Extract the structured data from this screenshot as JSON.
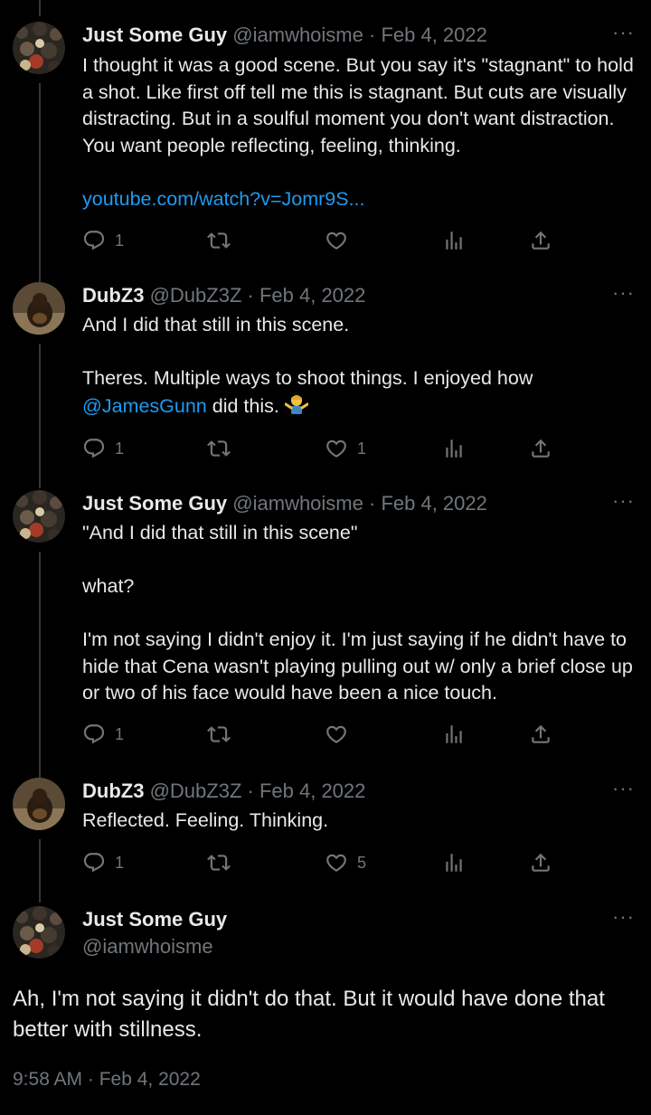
{
  "tweets": [
    {
      "name": "Just Some Guy",
      "handle": "@iamwhoisme",
      "sep": "·",
      "date": "Feb 4, 2022",
      "more": "···",
      "text1": "I thought it was a good scene. But you say it's \"stagnant\" to hold a shot. Like first off tell me this is stagnant. But cuts are visually distracting. But in a soulful moment you don't want distraction. You want people reflecting, feeling, thinking.",
      "link": "youtube.com/watch?v=Jomr9S...",
      "replies": "1",
      "likes": ""
    },
    {
      "name": "DubZ3",
      "handle": "@DubZ3Z",
      "sep": "·",
      "date": "Feb 4, 2022",
      "more": "···",
      "text1": "And I did that still in this scene.",
      "text2a": "Theres. Multiple ways to shoot things. I enjoyed how",
      "mention": "@JamesGunn",
      "text2b": "did this.",
      "emoji": "man-shrugging-emoji",
      "replies": "1",
      "likes": "1"
    },
    {
      "name": "Just Some Guy",
      "handle": "@iamwhoisme",
      "sep": "·",
      "date": "Feb 4, 2022",
      "more": "···",
      "text1": "\"And I did that still in this scene\"",
      "text2": "what?",
      "text3": "I'm not saying I didn't enjoy it. I'm just saying if he didn't have to hide that Cena wasn't playing pulling out w/ only a brief close up or two of his face would have been a nice touch.",
      "replies": "1",
      "likes": ""
    },
    {
      "name": "DubZ3",
      "handle": "@DubZ3Z",
      "sep": "·",
      "date": "Feb 4, 2022",
      "more": "···",
      "text1": "Reflected. Feeling. Thinking.",
      "replies": "1",
      "likes": "5"
    }
  ],
  "main": {
    "name": "Just Some Guy",
    "handle": "@iamwhoisme",
    "more": "···",
    "text": "Ah, I'm not saying it didn't do that. But it would have done that better with stillness.",
    "timestamp": "9:58 AM · Feb 4, 2022"
  },
  "colors": {
    "background": "#000000",
    "text": "#e7e9ea",
    "muted": "#71767b",
    "link": "#1d9bf0",
    "line": "#333639"
  },
  "icons": [
    "reply-icon",
    "retweet-icon",
    "like-icon",
    "views-icon",
    "share-icon",
    "more-icon"
  ]
}
